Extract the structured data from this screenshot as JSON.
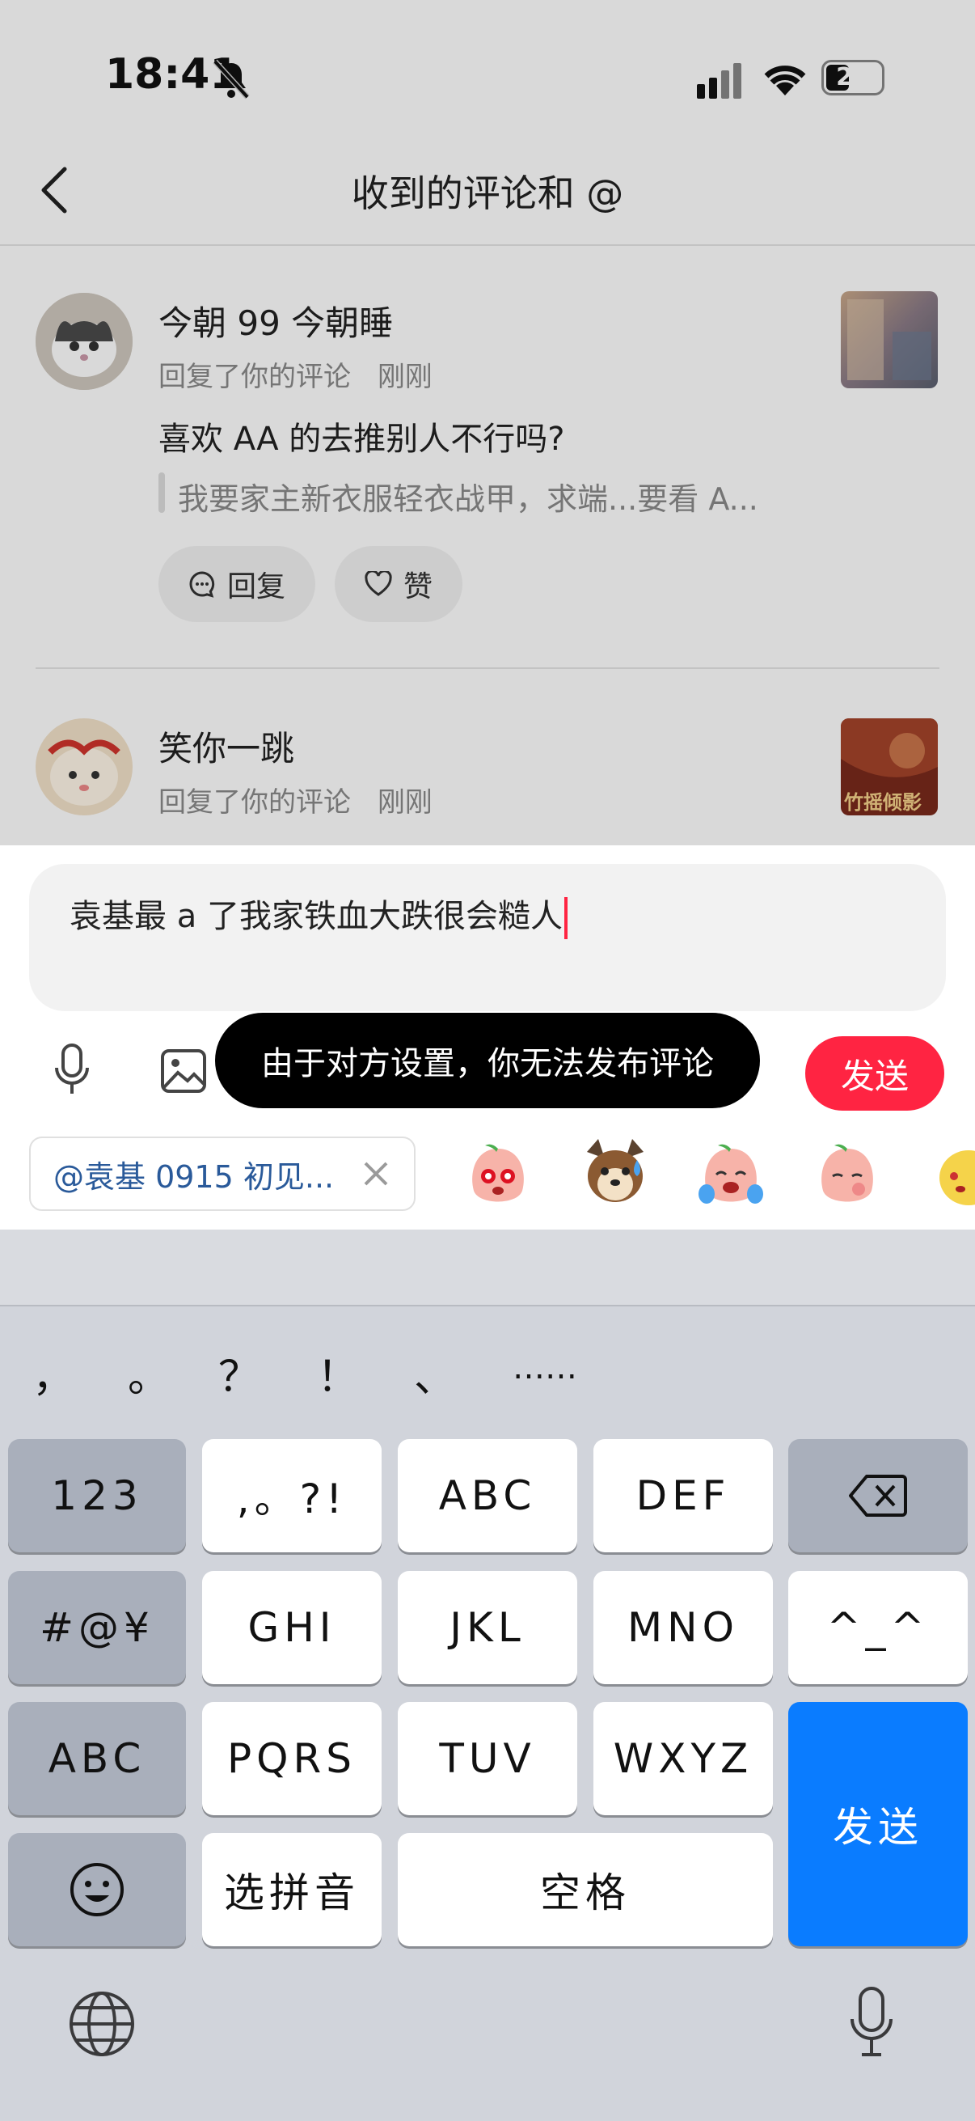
{
  "status_bar": {
    "time": "18:41",
    "battery": "23"
  },
  "header": {
    "title": "收到的评论和 @"
  },
  "notifications": [
    {
      "username": "今朝 99 今朝睡",
      "action": "回复了你的评论",
      "time": "刚刚",
      "comment": "喜欢 AA 的去推别人不行吗?",
      "quote": "我要家主新衣服轻衣战甲，求端...要看 A...",
      "reply_label": "回复",
      "like_label": "赞"
    },
    {
      "username": "笑你一跳",
      "action": "回复了你的评论",
      "time": "刚刚",
      "thumb_text": "竹摇倾影"
    }
  ],
  "composer": {
    "input_value": "袁基最 a 了我家铁血大跌很会糙人",
    "toast": "由于对方设置，你无法发布评论",
    "send_label": "发送",
    "mention_chip": "@袁基 0915 初见...",
    "accent": "#ff2442"
  },
  "keyboard": {
    "punctuation": [
      "，",
      "。",
      "？",
      "！",
      "、",
      "……"
    ],
    "row1": [
      "123",
      ",。?!",
      "ABC",
      "DEF"
    ],
    "row2": [
      "#@¥",
      "GHI",
      "JKL",
      "MNO",
      "^_^"
    ],
    "row3": [
      "ABC",
      "PQRS",
      "TUV",
      "WXYZ"
    ],
    "row4": [
      "选拼音",
      "空格"
    ],
    "send_label": "发送",
    "send_color": "#0a7cff"
  }
}
